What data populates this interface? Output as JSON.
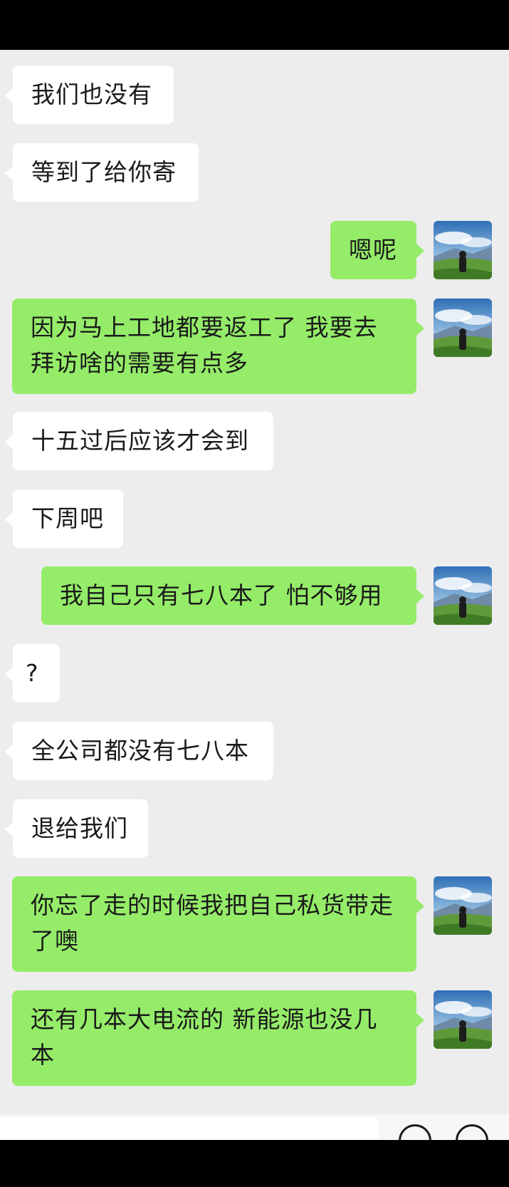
{
  "messages": [
    {
      "side": "in",
      "text": "我们也没有"
    },
    {
      "side": "in",
      "text": "等到了给你寄"
    },
    {
      "side": "out",
      "text": "嗯呢"
    },
    {
      "side": "out",
      "lines": [
        "因为马上工地都要返工了  我要去",
        "拜访啥的需要有点多"
      ]
    },
    {
      "side": "in",
      "text": "十五过后应该才会到"
    },
    {
      "side": "in",
      "text": "下周吧"
    },
    {
      "side": "out",
      "text": "我自己只有七八本了  怕不够用"
    },
    {
      "side": "in",
      "text": "?"
    },
    {
      "side": "in",
      "text": "全公司都没有七八本"
    },
    {
      "side": "in",
      "text": "退给我们"
    },
    {
      "side": "out",
      "lines": [
        "你忘了走的时候我把自己私货带走",
        "了噢"
      ]
    },
    {
      "side": "out",
      "lines": [
        "还有几本大电流的  新能源也没几",
        "本"
      ]
    }
  ],
  "colors": {
    "chat_bg": "#ededed",
    "incoming_bubble": "#ffffff",
    "outgoing_bubble": "#95ec69",
    "system_bars": "#000000"
  },
  "icons": {
    "avatar": "landscape-photo-avatar",
    "input_bar_buttons": [
      "voice-circle-icon",
      "add-circle-icon"
    ]
  }
}
